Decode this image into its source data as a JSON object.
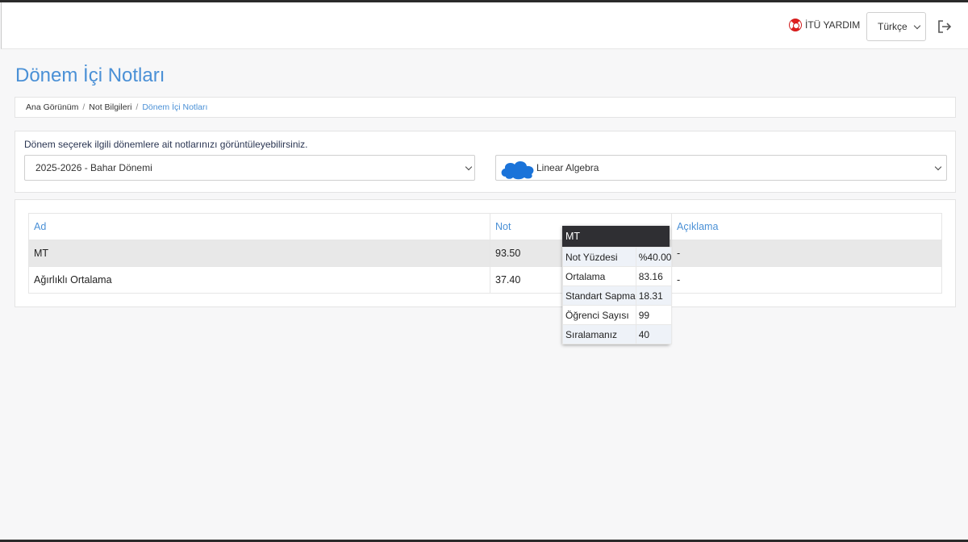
{
  "header": {
    "help_label": "İTÜ YARDIM",
    "language": "Türkçe"
  },
  "page": {
    "title": "Dönem İçi Notları"
  },
  "breadcrumb": {
    "items": [
      "Ana Görünüm",
      "Not Bilgileri",
      "Dönem İçi Notları"
    ]
  },
  "filters": {
    "hint": "Dönem seçerek ilgili dönemlere ait notlarınızı görüntüleyebilirsiniz.",
    "term_selected": "2025-2026 - Bahar Dönemi",
    "course_selected": "Linear Algebra"
  },
  "grades": {
    "columns": [
      "Ad",
      "Not",
      "Açıklama"
    ],
    "rows": [
      {
        "name": "MT",
        "grade": "93.50",
        "note": "-"
      },
      {
        "name": "Ağırlıklı Ortalama",
        "grade": "37.40",
        "note": "-"
      }
    ]
  },
  "tooltip": {
    "title": "MT",
    "rows": [
      {
        "label": "Not Yüzdesi",
        "value": "%40.00"
      },
      {
        "label": "Ortalama",
        "value": "83.16"
      },
      {
        "label": "Standart Sapma",
        "value": "18.31"
      },
      {
        "label": "Öğrenci Sayısı",
        "value": "99"
      },
      {
        "label": "Sıralamanız",
        "value": "40"
      }
    ]
  },
  "colors": {
    "accent": "#4a90d6",
    "tooltip_header": "#2f2f33",
    "help_icon": "#e02020",
    "censor_blob": "#1a73d9"
  },
  "icons": {
    "help": "lifebuoy-icon",
    "dropdown": "chevron-down-icon",
    "logout": "logout-icon"
  }
}
